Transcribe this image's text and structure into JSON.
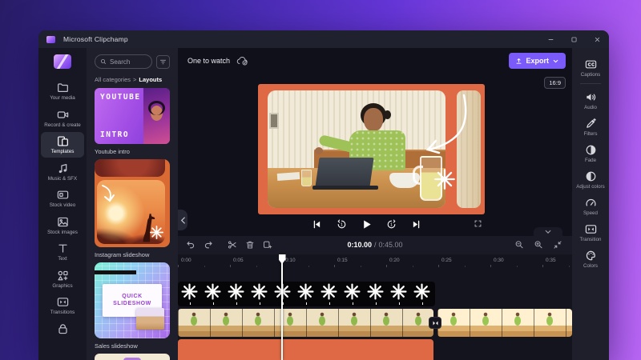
{
  "titlebar": {
    "app_title": "Microsoft Clipchamp"
  },
  "sidebar": {
    "items": [
      {
        "id": "your-media",
        "label": "Your media",
        "icon": "folder"
      },
      {
        "id": "record-create",
        "label": "Record & create",
        "icon": "camera"
      },
      {
        "id": "templates",
        "label": "Templates",
        "icon": "templates",
        "active": true
      },
      {
        "id": "music-sfx",
        "label": "Music & SFX",
        "icon": "music"
      },
      {
        "id": "stock-video",
        "label": "Stock video",
        "icon": "stockvideo"
      },
      {
        "id": "stock-images",
        "label": "Stock images",
        "icon": "stockimage"
      },
      {
        "id": "text",
        "label": "Text",
        "icon": "text"
      },
      {
        "id": "graphics",
        "label": "Graphics",
        "icon": "graphics"
      },
      {
        "id": "transitions",
        "label": "Transitions",
        "icon": "transition"
      },
      {
        "id": "brand-kit",
        "label": "",
        "icon": "bag"
      }
    ]
  },
  "templates_panel": {
    "search_placeholder": "Search",
    "breadcrumb": {
      "root": "All categories",
      "separator": ">",
      "current": "Layouts"
    },
    "cards": [
      {
        "name": "Youtube intro",
        "overlay_top": "YOUTUBE",
        "overlay_bottom": "INTRO"
      },
      {
        "name": "Instagram slideshow"
      },
      {
        "name": "Sales slideshow",
        "overlay_text": "QUICK SLIDESHOW"
      }
    ]
  },
  "preview": {
    "project_title": "One to watch",
    "export_label": "Export",
    "aspect_ratio": "16:9"
  },
  "timeline": {
    "current_time": "0:10.00",
    "separator": "/",
    "duration": "0:45.00",
    "ruler_labels": [
      "0:00",
      "0:05",
      "0:10",
      "0:15",
      "0:20",
      "0:25",
      "0:30",
      "0:35"
    ],
    "tracks": {
      "graphics": {
        "star_count": 11
      },
      "video": {
        "clip_count": 2
      },
      "color": {
        "clip_color": "#de6944"
      }
    }
  },
  "tools_panel": {
    "items": [
      {
        "id": "captions",
        "label": "Captions",
        "icon": "cc",
        "divider_after": true
      },
      {
        "id": "audio",
        "label": "Audio",
        "icon": "audio"
      },
      {
        "id": "filters",
        "label": "Filters",
        "icon": "filters"
      },
      {
        "id": "fade",
        "label": "Fade",
        "icon": "fade"
      },
      {
        "id": "adjust-colors",
        "label": "Adjust colors",
        "icon": "adjust"
      },
      {
        "id": "speed",
        "label": "Speed",
        "icon": "speed"
      },
      {
        "id": "transition",
        "label": "Transition",
        "icon": "transition"
      },
      {
        "id": "colors",
        "label": "Colors",
        "icon": "colors"
      }
    ]
  },
  "colors": {
    "accent": "#7a5af8",
    "clip_orange": "#de6944"
  }
}
